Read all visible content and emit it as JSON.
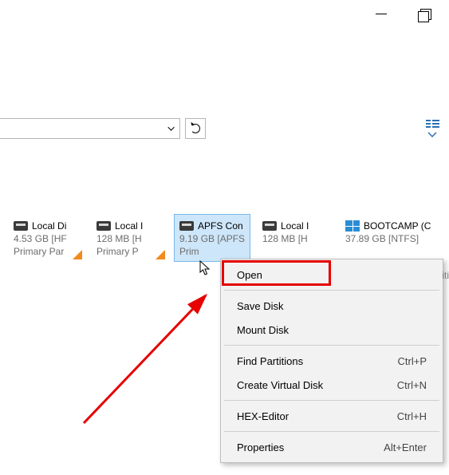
{
  "window_controls": {
    "minimize": "minimize",
    "maximize": "maximize"
  },
  "addressbar": {
    "value": "",
    "refresh_label": "Refresh"
  },
  "disks": [
    {
      "name": "Local Di",
      "size_line": "4.53 GB [HF",
      "part_line": "Primary Par",
      "icon": "disk",
      "health_flag": true
    },
    {
      "name": "Local I",
      "size_line": "128 MB [H",
      "part_line": "Primary P",
      "icon": "disk",
      "health_flag": true
    },
    {
      "name": "APFS Con",
      "size_line": "9.19 GB [APFS",
      "part_line": "Prim",
      "icon": "disk",
      "selected": true
    },
    {
      "name": "Local I",
      "size_line": "128 MB [H",
      "part_line": "",
      "icon": "disk"
    },
    {
      "name": "BOOTCAMP (C",
      "size_line": "37.89 GB [NTFS]",
      "part_line": "",
      "icon": "windows",
      "wide": true
    }
  ],
  "context_menu": {
    "items": [
      {
        "label": "Open",
        "shortcut": ""
      },
      {
        "sep": true
      },
      {
        "label": "Save Disk",
        "shortcut": ""
      },
      {
        "label": "Mount Disk",
        "shortcut": ""
      },
      {
        "sep": true
      },
      {
        "label": "Find Partitions",
        "shortcut": "Ctrl+P"
      },
      {
        "label": "Create Virtual Disk",
        "shortcut": "Ctrl+N"
      },
      {
        "sep": true
      },
      {
        "label": "HEX-Editor",
        "shortcut": "Ctrl+H"
      },
      {
        "sep": true
      },
      {
        "label": "Properties",
        "shortcut": "Alt+Enter"
      }
    ]
  },
  "edge_text": "iti",
  "annotation": {
    "arrow_target": "context-open",
    "highlight": "context-open"
  },
  "colors": {
    "select_bg": "#cde6f9",
    "select_border": "#7ab7e8",
    "accent_red": "#e60000"
  }
}
